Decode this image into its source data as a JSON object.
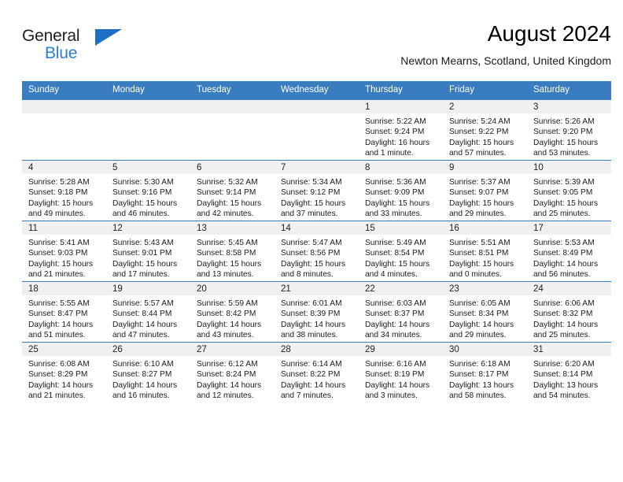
{
  "brand": {
    "name_top": "General",
    "name_bottom": "Blue",
    "triangle_color": "#1f6fc4",
    "blue_text_color": "#2b7fd1"
  },
  "header": {
    "title": "August 2024",
    "subtitle": "Newton Mearns, Scotland, United Kingdom"
  },
  "theme": {
    "header_bg": "#3a7cc0",
    "daynum_bg": "#f0f0f0",
    "grid_line": "#3a7cc0"
  },
  "weekdays": [
    "Sunday",
    "Monday",
    "Tuesday",
    "Wednesday",
    "Thursday",
    "Friday",
    "Saturday"
  ],
  "weeks": [
    [
      {
        "day": "",
        "empty": true,
        "sunrise": "",
        "sunset": "",
        "daylight_1": "",
        "daylight_2": ""
      },
      {
        "day": "",
        "empty": true,
        "sunrise": "",
        "sunset": "",
        "daylight_1": "",
        "daylight_2": ""
      },
      {
        "day": "",
        "empty": true,
        "sunrise": "",
        "sunset": "",
        "daylight_1": "",
        "daylight_2": ""
      },
      {
        "day": "",
        "empty": true,
        "sunrise": "",
        "sunset": "",
        "daylight_1": "",
        "daylight_2": ""
      },
      {
        "day": "1",
        "sunrise": "Sunrise: 5:22 AM",
        "sunset": "Sunset: 9:24 PM",
        "daylight_1": "Daylight: 16 hours",
        "daylight_2": "and 1 minute."
      },
      {
        "day": "2",
        "sunrise": "Sunrise: 5:24 AM",
        "sunset": "Sunset: 9:22 PM",
        "daylight_1": "Daylight: 15 hours",
        "daylight_2": "and 57 minutes."
      },
      {
        "day": "3",
        "sunrise": "Sunrise: 5:26 AM",
        "sunset": "Sunset: 9:20 PM",
        "daylight_1": "Daylight: 15 hours",
        "daylight_2": "and 53 minutes."
      }
    ],
    [
      {
        "day": "4",
        "sunrise": "Sunrise: 5:28 AM",
        "sunset": "Sunset: 9:18 PM",
        "daylight_1": "Daylight: 15 hours",
        "daylight_2": "and 49 minutes."
      },
      {
        "day": "5",
        "sunrise": "Sunrise: 5:30 AM",
        "sunset": "Sunset: 9:16 PM",
        "daylight_1": "Daylight: 15 hours",
        "daylight_2": "and 46 minutes."
      },
      {
        "day": "6",
        "sunrise": "Sunrise: 5:32 AM",
        "sunset": "Sunset: 9:14 PM",
        "daylight_1": "Daylight: 15 hours",
        "daylight_2": "and 42 minutes."
      },
      {
        "day": "7",
        "sunrise": "Sunrise: 5:34 AM",
        "sunset": "Sunset: 9:12 PM",
        "daylight_1": "Daylight: 15 hours",
        "daylight_2": "and 37 minutes."
      },
      {
        "day": "8",
        "sunrise": "Sunrise: 5:36 AM",
        "sunset": "Sunset: 9:09 PM",
        "daylight_1": "Daylight: 15 hours",
        "daylight_2": "and 33 minutes."
      },
      {
        "day": "9",
        "sunrise": "Sunrise: 5:37 AM",
        "sunset": "Sunset: 9:07 PM",
        "daylight_1": "Daylight: 15 hours",
        "daylight_2": "and 29 minutes."
      },
      {
        "day": "10",
        "sunrise": "Sunrise: 5:39 AM",
        "sunset": "Sunset: 9:05 PM",
        "daylight_1": "Daylight: 15 hours",
        "daylight_2": "and 25 minutes."
      }
    ],
    [
      {
        "day": "11",
        "sunrise": "Sunrise: 5:41 AM",
        "sunset": "Sunset: 9:03 PM",
        "daylight_1": "Daylight: 15 hours",
        "daylight_2": "and 21 minutes."
      },
      {
        "day": "12",
        "sunrise": "Sunrise: 5:43 AM",
        "sunset": "Sunset: 9:01 PM",
        "daylight_1": "Daylight: 15 hours",
        "daylight_2": "and 17 minutes."
      },
      {
        "day": "13",
        "sunrise": "Sunrise: 5:45 AM",
        "sunset": "Sunset: 8:58 PM",
        "daylight_1": "Daylight: 15 hours",
        "daylight_2": "and 13 minutes."
      },
      {
        "day": "14",
        "sunrise": "Sunrise: 5:47 AM",
        "sunset": "Sunset: 8:56 PM",
        "daylight_1": "Daylight: 15 hours",
        "daylight_2": "and 8 minutes."
      },
      {
        "day": "15",
        "sunrise": "Sunrise: 5:49 AM",
        "sunset": "Sunset: 8:54 PM",
        "daylight_1": "Daylight: 15 hours",
        "daylight_2": "and 4 minutes."
      },
      {
        "day": "16",
        "sunrise": "Sunrise: 5:51 AM",
        "sunset": "Sunset: 8:51 PM",
        "daylight_1": "Daylight: 15 hours",
        "daylight_2": "and 0 minutes."
      },
      {
        "day": "17",
        "sunrise": "Sunrise: 5:53 AM",
        "sunset": "Sunset: 8:49 PM",
        "daylight_1": "Daylight: 14 hours",
        "daylight_2": "and 56 minutes."
      }
    ],
    [
      {
        "day": "18",
        "sunrise": "Sunrise: 5:55 AM",
        "sunset": "Sunset: 8:47 PM",
        "daylight_1": "Daylight: 14 hours",
        "daylight_2": "and 51 minutes."
      },
      {
        "day": "19",
        "sunrise": "Sunrise: 5:57 AM",
        "sunset": "Sunset: 8:44 PM",
        "daylight_1": "Daylight: 14 hours",
        "daylight_2": "and 47 minutes."
      },
      {
        "day": "20",
        "sunrise": "Sunrise: 5:59 AM",
        "sunset": "Sunset: 8:42 PM",
        "daylight_1": "Daylight: 14 hours",
        "daylight_2": "and 43 minutes."
      },
      {
        "day": "21",
        "sunrise": "Sunrise: 6:01 AM",
        "sunset": "Sunset: 8:39 PM",
        "daylight_1": "Daylight: 14 hours",
        "daylight_2": "and 38 minutes."
      },
      {
        "day": "22",
        "sunrise": "Sunrise: 6:03 AM",
        "sunset": "Sunset: 8:37 PM",
        "daylight_1": "Daylight: 14 hours",
        "daylight_2": "and 34 minutes."
      },
      {
        "day": "23",
        "sunrise": "Sunrise: 6:05 AM",
        "sunset": "Sunset: 8:34 PM",
        "daylight_1": "Daylight: 14 hours",
        "daylight_2": "and 29 minutes."
      },
      {
        "day": "24",
        "sunrise": "Sunrise: 6:06 AM",
        "sunset": "Sunset: 8:32 PM",
        "daylight_1": "Daylight: 14 hours",
        "daylight_2": "and 25 minutes."
      }
    ],
    [
      {
        "day": "25",
        "sunrise": "Sunrise: 6:08 AM",
        "sunset": "Sunset: 8:29 PM",
        "daylight_1": "Daylight: 14 hours",
        "daylight_2": "and 21 minutes."
      },
      {
        "day": "26",
        "sunrise": "Sunrise: 6:10 AM",
        "sunset": "Sunset: 8:27 PM",
        "daylight_1": "Daylight: 14 hours",
        "daylight_2": "and 16 minutes."
      },
      {
        "day": "27",
        "sunrise": "Sunrise: 6:12 AM",
        "sunset": "Sunset: 8:24 PM",
        "daylight_1": "Daylight: 14 hours",
        "daylight_2": "and 12 minutes."
      },
      {
        "day": "28",
        "sunrise": "Sunrise: 6:14 AM",
        "sunset": "Sunset: 8:22 PM",
        "daylight_1": "Daylight: 14 hours",
        "daylight_2": "and 7 minutes."
      },
      {
        "day": "29",
        "sunrise": "Sunrise: 6:16 AM",
        "sunset": "Sunset: 8:19 PM",
        "daylight_1": "Daylight: 14 hours",
        "daylight_2": "and 3 minutes."
      },
      {
        "day": "30",
        "sunrise": "Sunrise: 6:18 AM",
        "sunset": "Sunset: 8:17 PM",
        "daylight_1": "Daylight: 13 hours",
        "daylight_2": "and 58 minutes."
      },
      {
        "day": "31",
        "sunrise": "Sunrise: 6:20 AM",
        "sunset": "Sunset: 8:14 PM",
        "daylight_1": "Daylight: 13 hours",
        "daylight_2": "and 54 minutes."
      }
    ]
  ]
}
